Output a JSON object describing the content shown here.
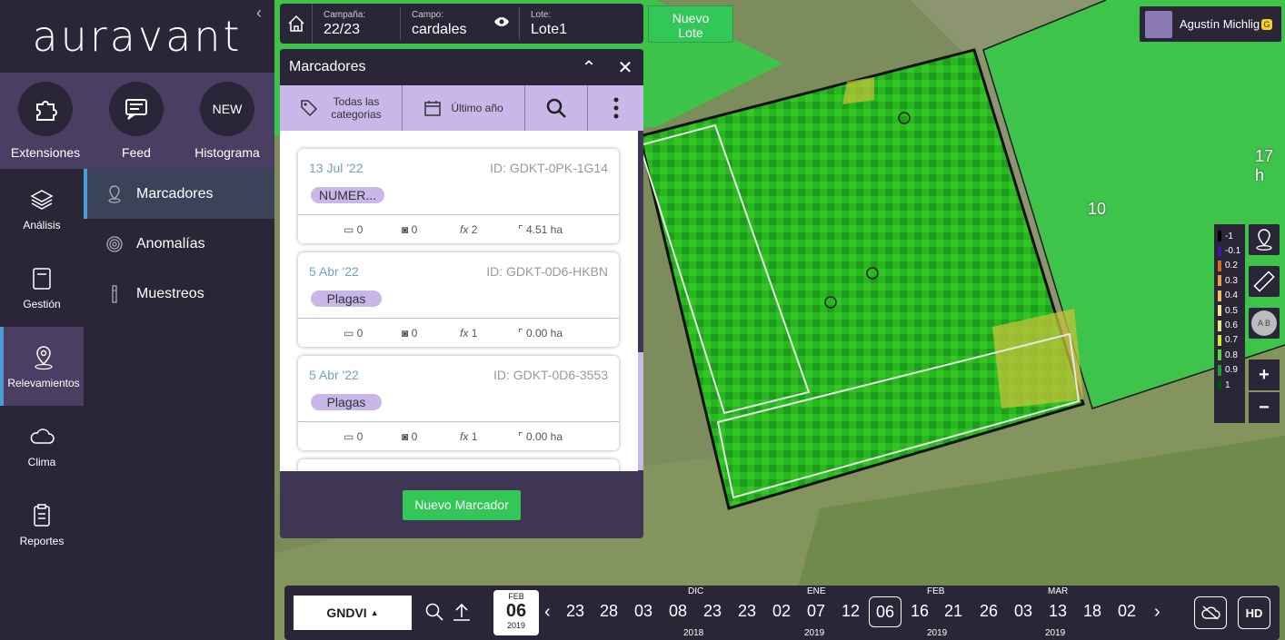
{
  "app": {
    "logo": "auravant"
  },
  "top_apps": [
    {
      "label": "Extensiones",
      "icon": "puzzle-icon"
    },
    {
      "label": "Feed",
      "icon": "feed-icon"
    },
    {
      "label": "Histograma",
      "icon": "new-icon",
      "badge": "NEW"
    }
  ],
  "nav": [
    {
      "label": "Análisis",
      "icon": "layers-icon"
    },
    {
      "label": "Gestión",
      "icon": "clipboard-icon"
    },
    {
      "label": "Relevamientos",
      "icon": "pin-icon",
      "active": true
    },
    {
      "label": "Clima",
      "icon": "cloud-icon"
    },
    {
      "label": "Reportes",
      "icon": "report-icon"
    }
  ],
  "subnav": [
    {
      "label": "Marcadores",
      "active": true
    },
    {
      "label": "Anomalías"
    },
    {
      "label": "Muestreos"
    }
  ],
  "topbar": {
    "campania_label": "Campaña:",
    "campania": "22/23",
    "campo_label": "Campo:",
    "campo": "cardales",
    "lote_label": "Lote:",
    "lote": "Lote1",
    "nuevo_lote": "Nuevo\nLote"
  },
  "panel": {
    "title": "Marcadores",
    "filter_categories": "Todas las\ncategorias",
    "filter_period": "Último año",
    "new_marker": "Nuevo Marcador",
    "cards": [
      {
        "date": "13 Jul '22",
        "id": "ID: GDKT-0PK-1G14",
        "tag": "NUMER...",
        "comments": "0",
        "photos": "0",
        "fx": "2",
        "area": "4.51 ha"
      },
      {
        "date": "5 Abr '22",
        "id": "ID: GDKT-0D6-HKBN",
        "tag": "Plagas",
        "comments": "0",
        "photos": "0",
        "fx": "1",
        "area": "0.00 ha"
      },
      {
        "date": "5 Abr '22",
        "id": "ID: GDKT-0D6-3553",
        "tag": "Plagas",
        "comments": "0",
        "photos": "0",
        "fx": "1",
        "area": "0.00 ha"
      }
    ]
  },
  "user": {
    "name": "Agustín Michlig",
    "badge": "G"
  },
  "map": {
    "labels": {
      "field10": "10",
      "field17": "17 h"
    },
    "legend": [
      {
        "label": "-1",
        "color": "#000000"
      },
      {
        "label": "-0.1",
        "color": "#3b1aa8"
      },
      {
        "label": "0.2",
        "color": "#d96b1c"
      },
      {
        "label": "0.3",
        "color": "#e8a14a"
      },
      {
        "label": "0.4",
        "color": "#f0c05a"
      },
      {
        "label": "0.5",
        "color": "#f3e58a"
      },
      {
        "label": "0.6",
        "color": "#e4f07a"
      },
      {
        "label": "0.7",
        "color": "#c9ea3a"
      },
      {
        "label": "0.8",
        "color": "#5fd43b"
      },
      {
        "label": "0.9",
        "color": "#1f9c2a"
      },
      {
        "label": "1",
        "color": "#0a4a14"
      }
    ],
    "zoom_in": "+",
    "zoom_out": "−",
    "ab": "A B"
  },
  "timeline": {
    "index": "GNDVI",
    "cal": {
      "month": "FEB",
      "day": "06",
      "year": "2019"
    },
    "dates": [
      "23",
      "28",
      "03",
      "08",
      "23",
      "23",
      "02",
      "07",
      "12",
      "06",
      "16",
      "21",
      "26",
      "03",
      "13",
      "18",
      "02"
    ],
    "selected_index": 9,
    "months": {
      "dic": "DIC",
      "ene": "ENE",
      "feb": "FEB",
      "mar": "MAR"
    },
    "years": {
      "y2018": "2018",
      "y2019a": "2019",
      "y2019b": "2019",
      "y2019c": "2019"
    },
    "hd": "HD"
  }
}
